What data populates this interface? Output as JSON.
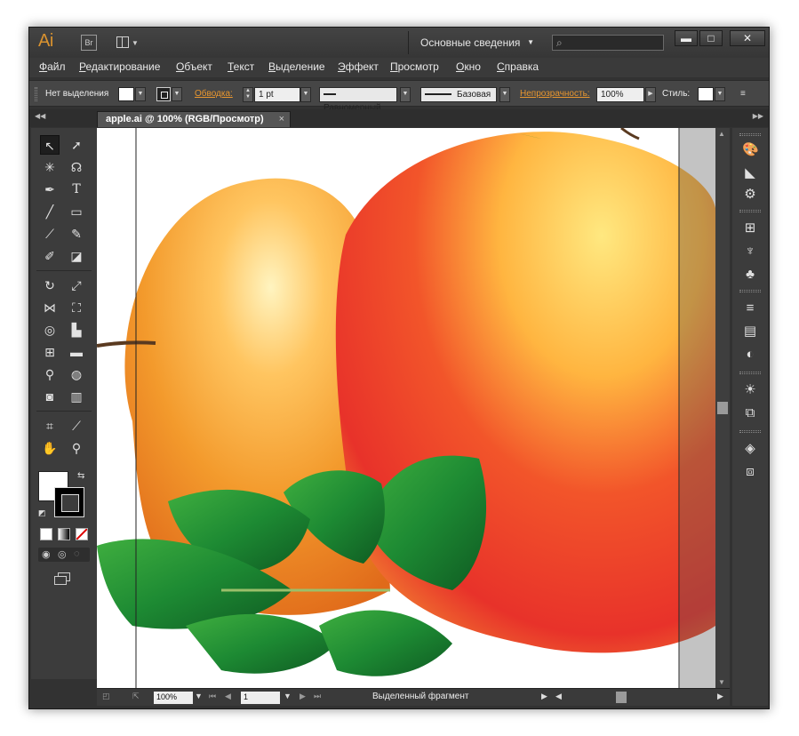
{
  "titlebar": {
    "logo": "Ai",
    "bridge": "Br",
    "workspace": "Основные сведения",
    "search_placeholder": "",
    "minimize_glyph": "▬",
    "maximize_glyph": "□",
    "close_glyph": "✕"
  },
  "menu": {
    "items": [
      "Файл",
      "Редактирование",
      "Объект",
      "Текст",
      "Выделение",
      "Эффект",
      "Просмотр",
      "Окно",
      "Справка"
    ]
  },
  "control": {
    "selection": "Нет выделения",
    "stroke_label": "Обводка:",
    "stroke_weight": "1 pt",
    "profile": "Равномерный",
    "brush": "Базовая",
    "opacity_label": "Непрозрачность:",
    "opacity_value": "100%",
    "style_label": "Стиль:"
  },
  "document": {
    "tab_title": "apple.ai @ 100% (RGB/Просмотр)",
    "tab_close": "×"
  },
  "status": {
    "zoom": "100%",
    "page": "1",
    "text": "Выделенный фрагмент"
  },
  "colors": {
    "accent_orange": "#e8962f",
    "ui_dark": "#323232"
  },
  "icons": {
    "tools": [
      "selection-tool",
      "direct-selection-tool",
      "magic-wand-tool",
      "lasso-tool",
      "pen-tool",
      "type-tool",
      "line-tool",
      "rectangle-tool",
      "paintbrush-tool",
      "pencil-tool",
      "blob-brush-tool",
      "eraser-tool",
      "rotate-tool",
      "scale-tool",
      "width-tool",
      "free-transform-tool",
      "shape-builder-tool",
      "chart-tool",
      "mesh-tool",
      "gradient-tool",
      "eyedropper-tool",
      "blend-tool",
      "symbol-sprayer-tool",
      "column-graph-tool",
      "artboard-tool",
      "slice-tool",
      "hand-tool",
      "zoom-tool"
    ],
    "panels": [
      "color-panel",
      "color-guide-panel",
      "brushes-panel",
      "swatches-panel",
      "symbols-panel",
      "clubs-panel",
      "stroke-panel",
      "gradient-panel",
      "transparency-panel",
      "appearance-panel",
      "graphic-styles-panel",
      "layers-panel",
      "artboards-panel"
    ]
  }
}
